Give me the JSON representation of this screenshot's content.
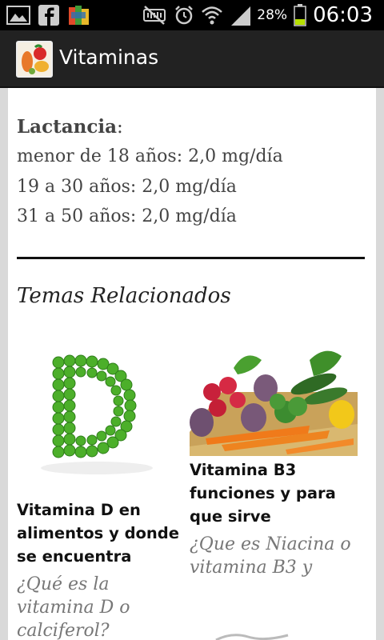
{
  "status_bar": {
    "icons_left": [
      "gallery-icon",
      "facebook-icon",
      "app-icon"
    ],
    "icons_right": [
      "mute-icon",
      "alarm-icon",
      "wifi-icon",
      "signal-icon",
      "battery-icon"
    ],
    "battery_percent": "28%",
    "time": "06:03"
  },
  "action_bar": {
    "title": "Vitaminas"
  },
  "lactancia": {
    "label": "Lactancia",
    "colon": ":",
    "lines": [
      "menor de 18 años: 2,0 mg/día",
      "19 a 30 años: 2,0 mg/día",
      "31 a 50 años: 2,0 mg/día"
    ]
  },
  "related": {
    "heading": "Temas Relacionados",
    "items": [
      {
        "title_lines": [
          "Vitamina D en",
          "alimentos y donde",
          "se encuentra"
        ],
        "excerpt_lines": [
          "¿Qué es la",
          "vitamina D o",
          "calciferol?"
        ]
      },
      {
        "title_lines": [
          "Vitamina B3",
          "funciones y para",
          "que sirve"
        ],
        "excerpt_lines": [
          "¿Que es Niacina o",
          "vitamina B3 y"
        ]
      }
    ]
  },
  "colors": {
    "status_bar": "#000000",
    "action_bar": "#222222",
    "background": "#d9d9d9",
    "card": "#ffffff",
    "battery": "#b6e000"
  }
}
